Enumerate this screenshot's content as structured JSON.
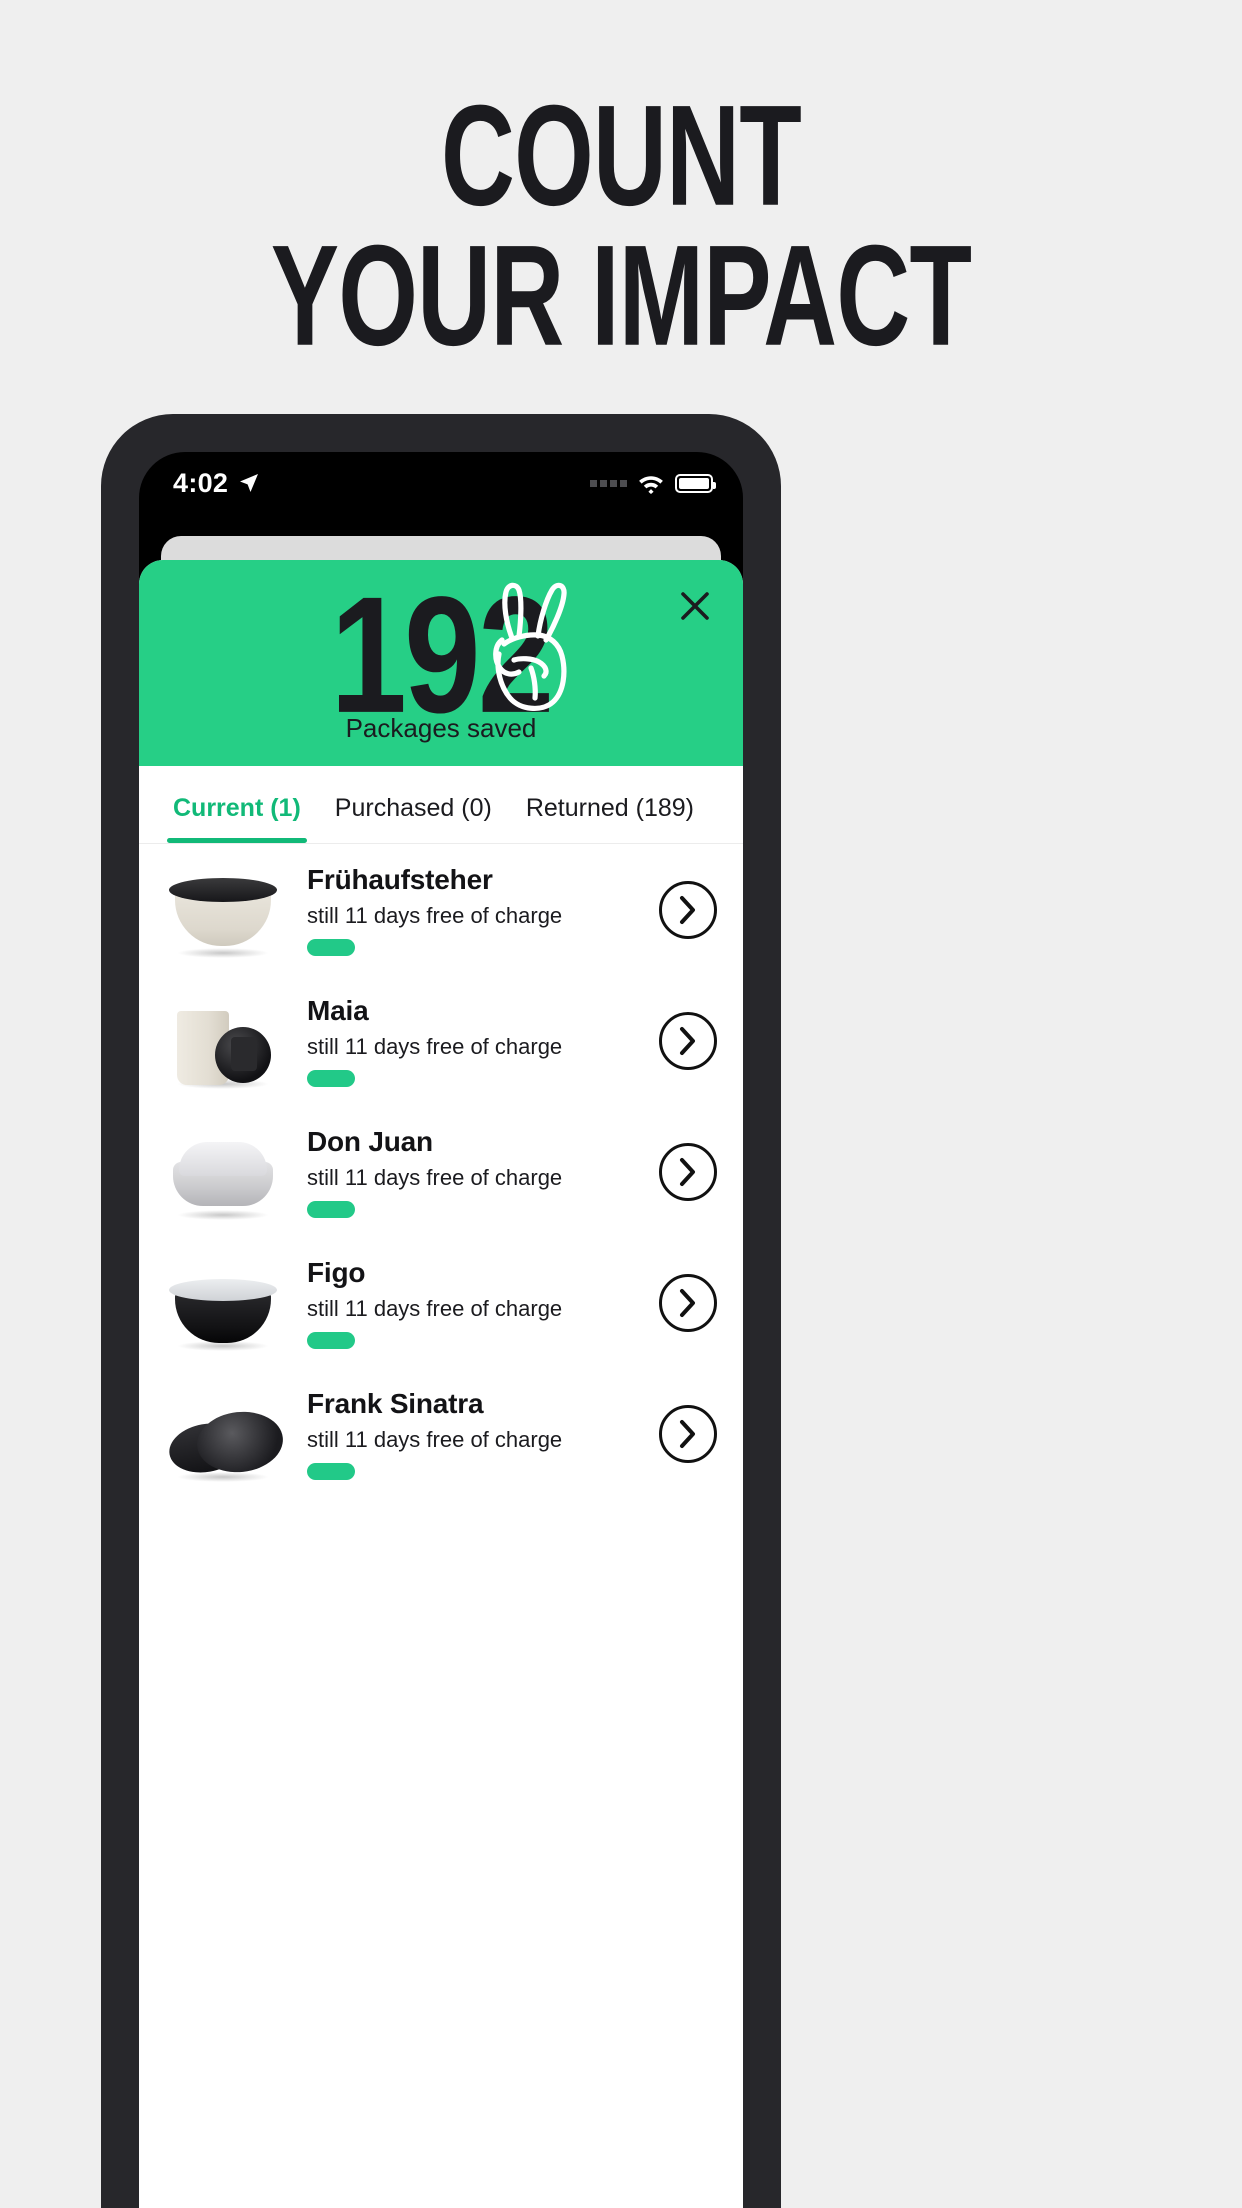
{
  "poster": {
    "headline_line1": "COUNT",
    "headline_line2": "YOUR IMPACT",
    "background_color": "#efefef"
  },
  "phone": {
    "status_bar": {
      "time": "4:02",
      "location_icon": "location-arrow-icon",
      "signal_icon": "signal-dots-icon",
      "wifi_icon": "wifi-icon",
      "battery_icon": "battery-full-icon"
    }
  },
  "modal": {
    "hero": {
      "count": "192",
      "label": "Packages saved",
      "peace_icon": "peace-hand-icon",
      "close_icon": "close-icon",
      "background_color": "#26cf86"
    },
    "tabs": [
      {
        "label": "Current (1)",
        "active": true
      },
      {
        "label": "Purchased (0)",
        "active": false
      },
      {
        "label": "Returned (189)",
        "active": false
      }
    ],
    "accent_color": "#11b978",
    "items": [
      {
        "title": "Frühaufsteher",
        "subtitle": "still 11 days free of charge",
        "thumb": "cream-bowl-black-lid",
        "chevron_icon": "chevron-right-icon"
      },
      {
        "title": "Maia",
        "subtitle": "still 11 days free of charge",
        "thumb": "cream-cup-black-lid",
        "chevron_icon": "chevron-right-icon"
      },
      {
        "title": "Don Juan",
        "subtitle": "still 11 days free of charge",
        "thumb": "clear-container",
        "chevron_icon": "chevron-right-icon"
      },
      {
        "title": "Figo",
        "subtitle": "still 11 days free of charge",
        "thumb": "black-bowl-clear-lid",
        "chevron_icon": "chevron-right-icon"
      },
      {
        "title": "Frank Sinatra",
        "subtitle": "still 11 days free of charge",
        "thumb": "black-stacked-lids",
        "chevron_icon": "chevron-right-icon"
      }
    ]
  }
}
